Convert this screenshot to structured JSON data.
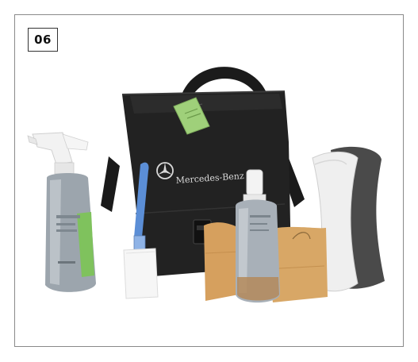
{
  "panel": {
    "number": "06"
  },
  "bag": {
    "brand_text": "Mercedes-Benz"
  },
  "colors": {
    "bag": "#1f1f1f",
    "tag": "#9fd07a",
    "spray_bottle": "#9ca5ad",
    "label_green": "#7fc25d",
    "brush_handle": "#5b8ed6",
    "chamois": "#d6a05e",
    "sponge_dark": "#4a4a4a",
    "sponge_light": "#eeeeee"
  }
}
